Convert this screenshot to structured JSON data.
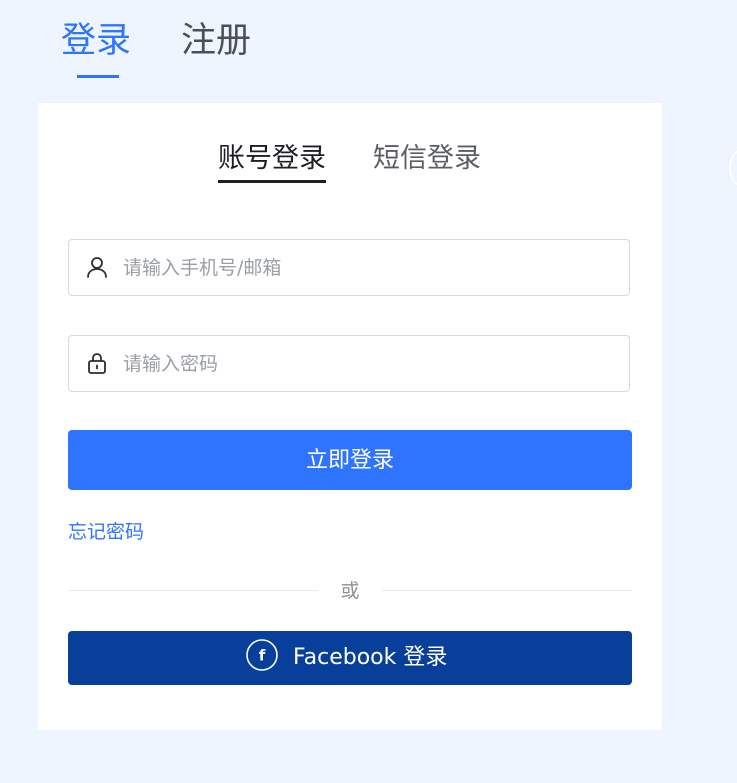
{
  "top_tabs": {
    "login": "登录",
    "register": "注册"
  },
  "card": {
    "subtabs": {
      "account": "账号登录",
      "sms": "短信登录"
    },
    "username_field": {
      "icon": "user-icon",
      "placeholder": "请输入手机号/邮箱",
      "value": ""
    },
    "password_field": {
      "icon": "lock-icon",
      "placeholder": "请输入密码",
      "value": ""
    },
    "submit_label": "立即登录",
    "forgot_label": "忘记密码",
    "divider_text": "或",
    "facebook_label": "Facebook 登录",
    "facebook_icon": "facebook-icon"
  },
  "colors": {
    "accent": "#2f74ff",
    "facebook": "#083f9b",
    "background": "#eef5ff"
  }
}
